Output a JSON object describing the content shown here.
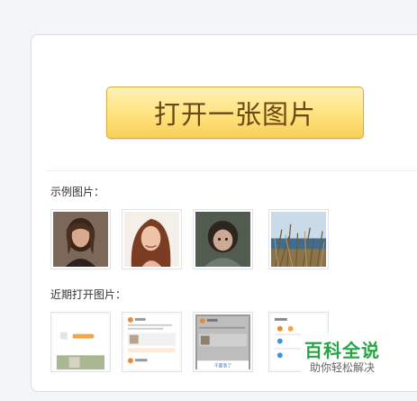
{
  "open_button": {
    "label": "打开一张图片"
  },
  "sample_section": {
    "label": "示例图片："
  },
  "recent_section": {
    "label": "近期打开图片："
  },
  "recent_thumbs": [
    {
      "caption": ""
    },
    {
      "caption": ""
    },
    {
      "caption": "不要事了"
    },
    {
      "caption": ""
    }
  ],
  "watermark": {
    "title": "百科全说",
    "subtitle": "助你轻松解决"
  },
  "colors": {
    "button_top": "#fff2b8",
    "button_bottom": "#f8cf5a",
    "button_text": "#6b4714",
    "watermark": "#27a546"
  }
}
